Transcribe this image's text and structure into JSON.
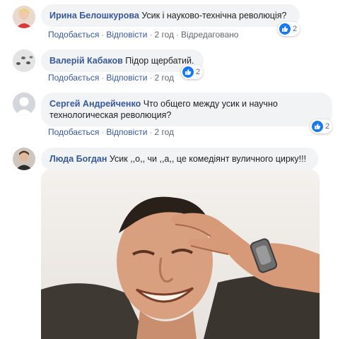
{
  "comments": [
    {
      "author": "Ирина Белошкурова",
      "text": "Усик і науково-технічна революція?",
      "like": "Подобається",
      "reply": "Відповісти",
      "time": "2 год",
      "edited": "Відредаговано",
      "reactions": "2"
    },
    {
      "author": "Валерій Кабаков",
      "text": "Підор щербатий.",
      "like": "Подобається",
      "reply": "Відповісти",
      "time": "2 год",
      "reactions": "2"
    },
    {
      "author": "Сергей Андрейченко",
      "text": "Что общего между усик и научно технологическая революция?",
      "like": "Подобається",
      "reply": "Відповісти",
      "time": "2 год",
      "reactions": "2"
    },
    {
      "author": "Люда Богдан",
      "text": "Усик ,,о,, чи ,,а,, це комедіянт вуличного цирку!!!"
    }
  ],
  "colors": {
    "name": "#385898",
    "bubble": "#f2f3f5",
    "like_badge": "#1877f2",
    "meta": "#616770"
  },
  "icons": [
    "like-icon",
    "facepalm-gif"
  ]
}
